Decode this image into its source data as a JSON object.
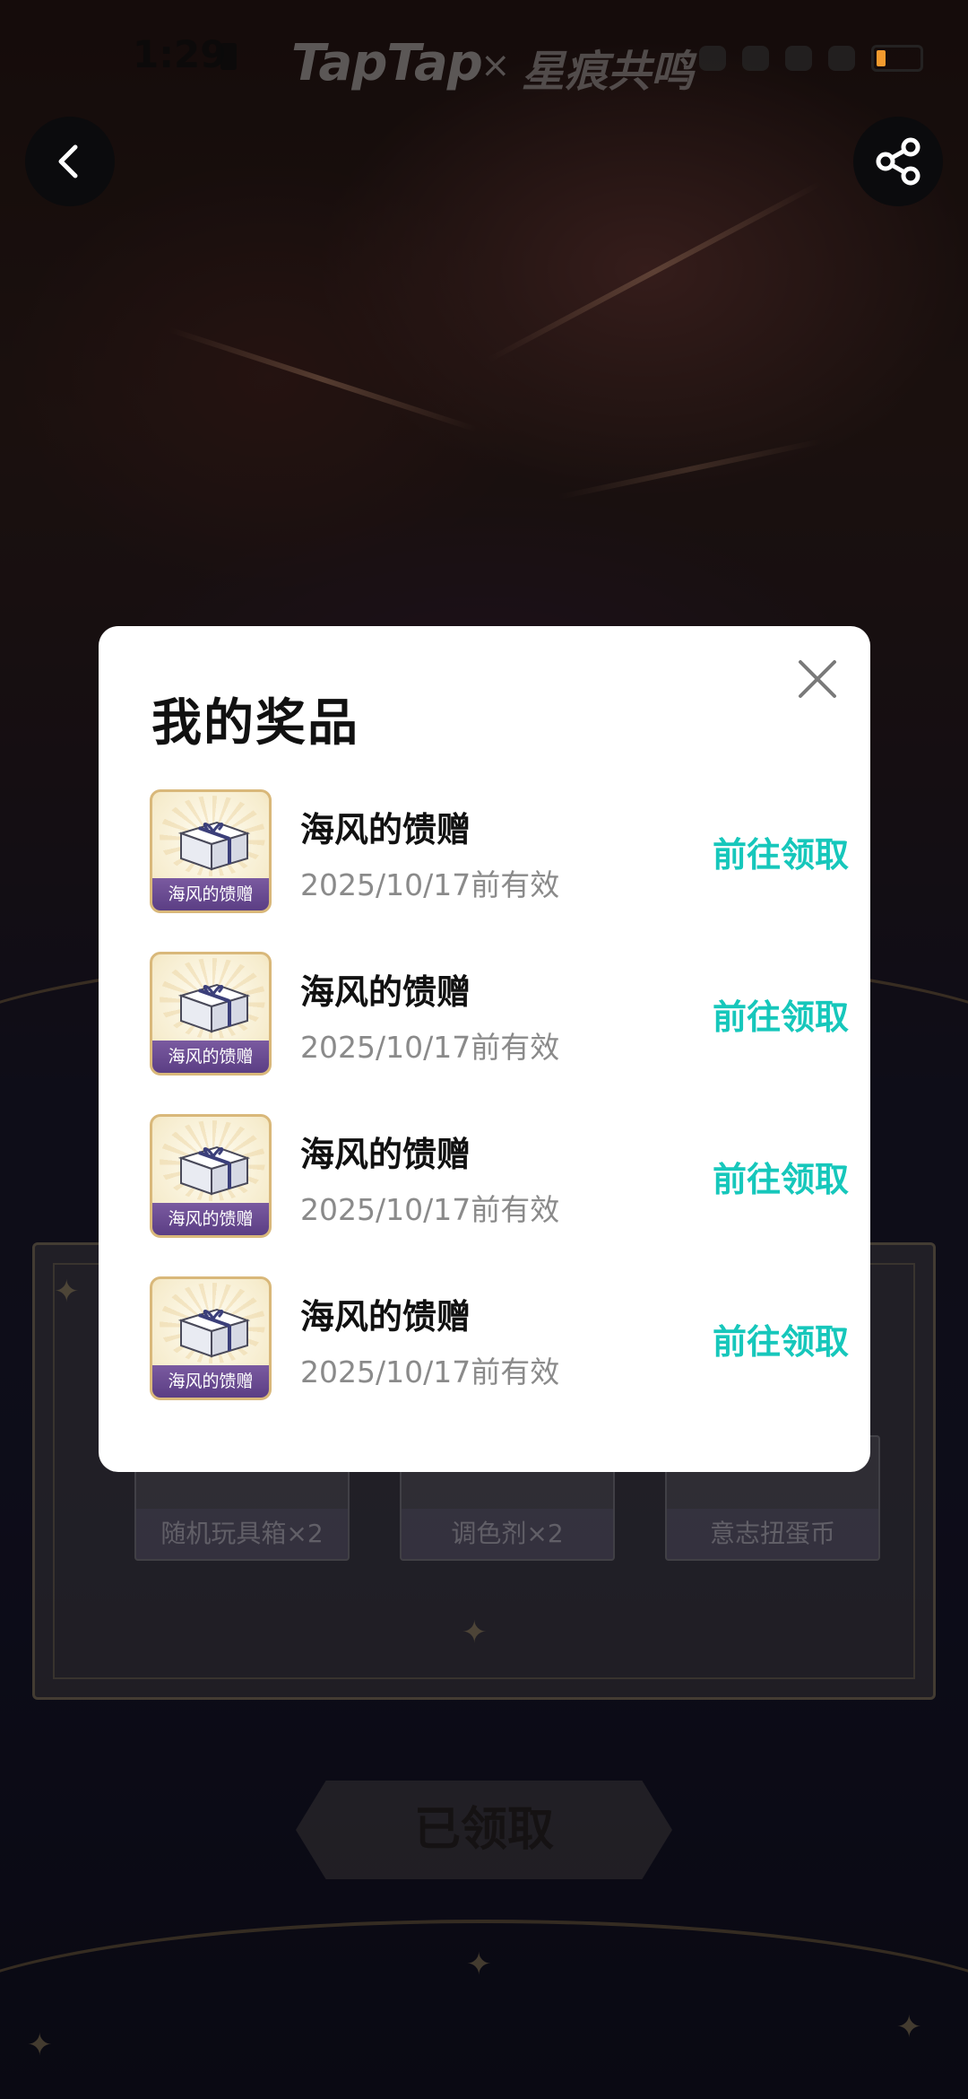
{
  "status_bar": {
    "time": "1:29",
    "brand": "TapTap",
    "separator": "×",
    "game_logo": "星痕共鸣",
    "battery_color": "#f29a2e"
  },
  "nav": {
    "back_icon": "chevron-left-icon",
    "share_icon": "share-icon"
  },
  "background": {
    "rewards": [
      "随机玩具箱×2",
      "调色剂×2",
      "意志扭蛋币"
    ],
    "claimed_label": "已领取"
  },
  "modal": {
    "title": "我的奖品",
    "close_icon": "close-icon",
    "accent_color": "#16c7bb",
    "prizes": [
      {
        "thumb_label": "海风的馈赠",
        "name": "海风的馈赠",
        "expiry": "2025/10/17前有效",
        "action": "前往领取"
      },
      {
        "thumb_label": "海风的馈赠",
        "name": "海风的馈赠",
        "expiry": "2025/10/17前有效",
        "action": "前往领取"
      },
      {
        "thumb_label": "海风的馈赠",
        "name": "海风的馈赠",
        "expiry": "2025/10/17前有效",
        "action": "前往领取"
      },
      {
        "thumb_label": "海风的馈赠",
        "name": "海风的馈赠",
        "expiry": "2025/10/17前有效",
        "action": "前往领取"
      }
    ]
  }
}
